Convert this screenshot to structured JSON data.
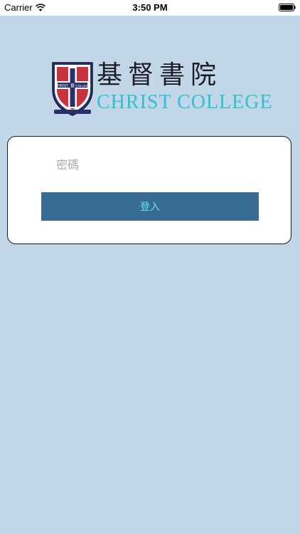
{
  "status_bar": {
    "carrier": "Carrier",
    "time": "3:50 PM"
  },
  "logo": {
    "chinese_name": "基督書院",
    "english_name": "CHRIST COLLEGE",
    "crest_text_left": "CHRIST",
    "crest_text_center": "督",
    "crest_text_right": "COLLEGE"
  },
  "login": {
    "password_placeholder": "密碼",
    "password_value": "",
    "submit_label": "登入"
  },
  "colors": {
    "background": "#c1d6e6",
    "button": "#386c92",
    "button_text": "#66e5ef",
    "english_name": "#2fc1cf"
  }
}
